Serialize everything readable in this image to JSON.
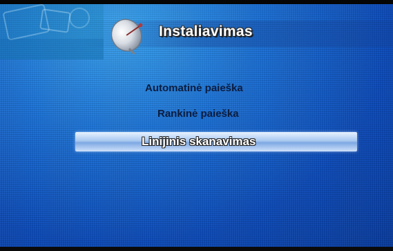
{
  "header": {
    "title": "Instaliavimas",
    "icon": "satellite-dish-icon"
  },
  "menu": {
    "items": [
      {
        "label": "Automatinė paieška",
        "selected": false
      },
      {
        "label": "Rankinė paieška",
        "selected": false
      },
      {
        "label": "Linijinis skanavimas",
        "selected": true
      }
    ]
  },
  "colors": {
    "background": "#1c6fd0",
    "highlight": "#a9c8f0",
    "menu_text": "#0b1c3e",
    "selected_text": "#ffffff"
  }
}
